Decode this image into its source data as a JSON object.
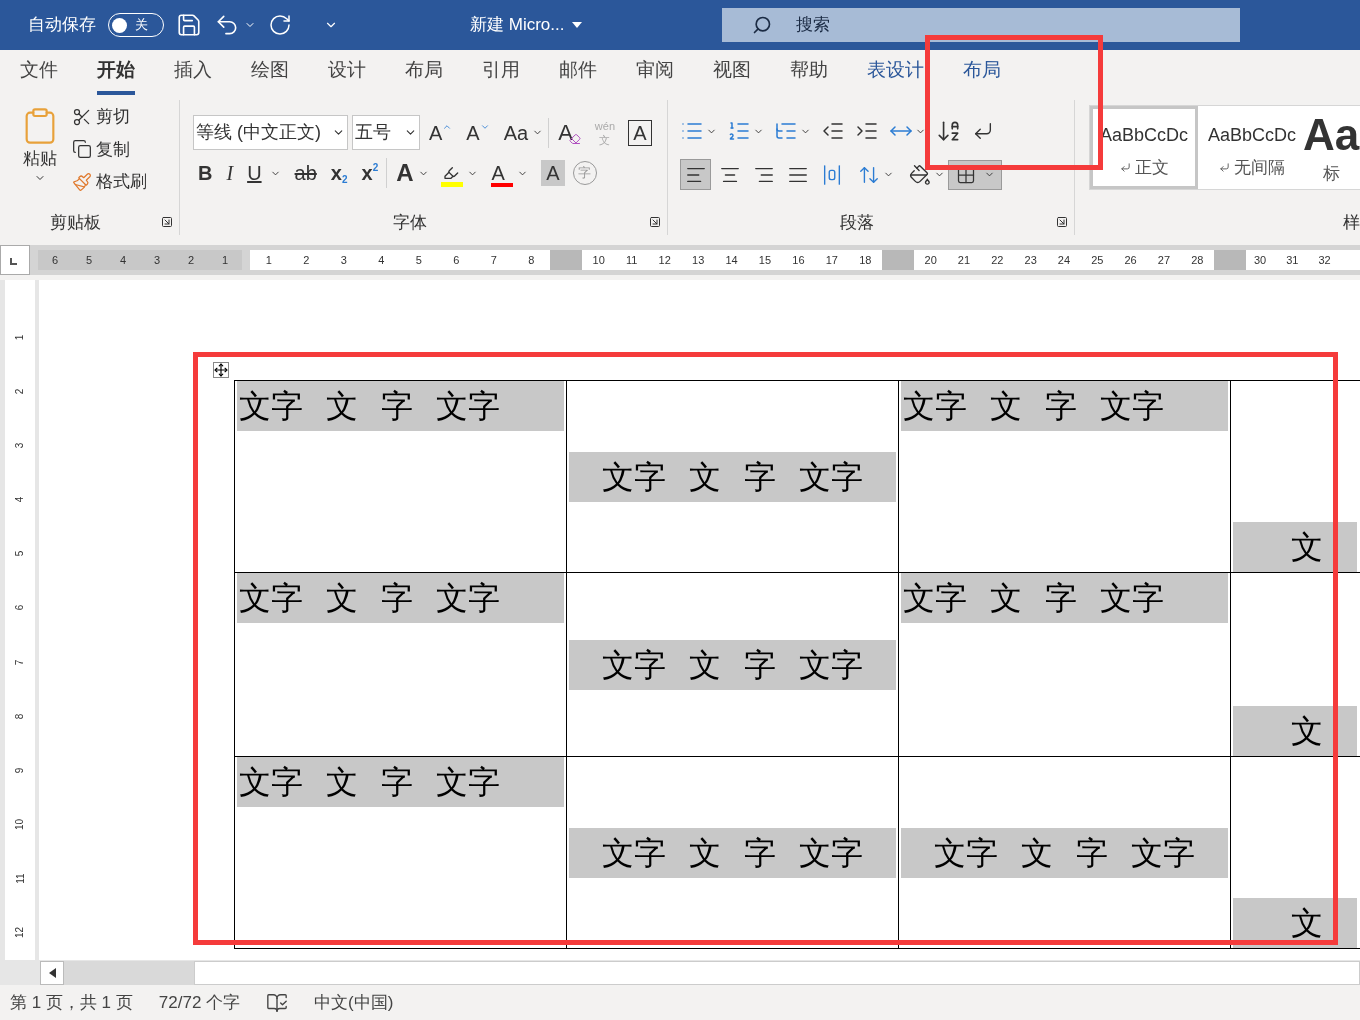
{
  "title_bar": {
    "autosave_label": "自动保存",
    "autosave": {
      "label": "关",
      "on": false
    },
    "doc_title": "新建 Micro...",
    "search": {
      "placeholder": "搜索"
    }
  },
  "tabs": [
    {
      "label": "文件",
      "selected": false,
      "kind": "normal"
    },
    {
      "label": "开始",
      "selected": true,
      "kind": "normal"
    },
    {
      "label": "插入",
      "selected": false,
      "kind": "normal"
    },
    {
      "label": "绘图",
      "selected": false,
      "kind": "normal"
    },
    {
      "label": "设计",
      "selected": false,
      "kind": "normal"
    },
    {
      "label": "布局",
      "selected": false,
      "kind": "normal"
    },
    {
      "label": "引用",
      "selected": false,
      "kind": "normal"
    },
    {
      "label": "邮件",
      "selected": false,
      "kind": "normal"
    },
    {
      "label": "审阅",
      "selected": false,
      "kind": "normal"
    },
    {
      "label": "视图",
      "selected": false,
      "kind": "normal"
    },
    {
      "label": "帮助",
      "selected": false,
      "kind": "normal"
    },
    {
      "label": "表设计",
      "selected": false,
      "kind": "context"
    },
    {
      "label": "布局",
      "selected": false,
      "kind": "context"
    }
  ],
  "clipboard": {
    "paste": "粘贴",
    "items": [
      {
        "label": "剪切",
        "kind": "cut"
      },
      {
        "label": "复制",
        "kind": "copy"
      },
      {
        "label": "格式刷",
        "kind": "painter"
      }
    ],
    "group_label": "剪贴板"
  },
  "font": {
    "font_name": "等线 (中文正文)",
    "font_size": "五号",
    "group_label": "字体",
    "row1": [
      {
        "kind": "grow",
        "glyph": "A"
      },
      {
        "kind": "shrink",
        "glyph": "A"
      },
      {
        "kind": "case",
        "glyph": "Aa"
      },
      {
        "kind": "clear",
        "glyph": "A"
      },
      {
        "kind": "phonetic",
        "top": "wén",
        "glyph": "文"
      },
      {
        "kind": "boxed",
        "glyph": "A"
      }
    ],
    "row2": [
      {
        "kind": "bold",
        "glyph": "B"
      },
      {
        "kind": "italic",
        "glyph": "I"
      },
      {
        "kind": "underline",
        "glyph": "U"
      },
      {
        "kind": "strike",
        "glyph": "ab"
      },
      {
        "kind": "sub",
        "glyph": "x",
        "small": "2"
      },
      {
        "kind": "sup",
        "glyph": "x",
        "small": "2"
      },
      {
        "kind": "effects",
        "glyph": "A"
      },
      {
        "kind": "highlight",
        "color": "#ffff00"
      },
      {
        "kind": "color",
        "glyph": "A",
        "color": "#ff0000"
      },
      {
        "kind": "shade",
        "glyph": "A"
      },
      {
        "kind": "enclose",
        "glyph": "字"
      }
    ]
  },
  "paragraph": {
    "group_label": "段落",
    "alignment": [
      {
        "kind": "left",
        "selected": true
      },
      {
        "kind": "center",
        "selected": false
      },
      {
        "kind": "right",
        "selected": false
      },
      {
        "kind": "justify",
        "selected": false
      },
      {
        "kind": "distribute",
        "selected": false
      }
    ]
  },
  "styles": {
    "items": [
      {
        "preview": "AaBbCcDc",
        "name": "正文",
        "selected": true,
        "kind": "normal"
      },
      {
        "preview": "AaBbCcDc",
        "name": "无间隔",
        "selected": false,
        "kind": "normal"
      },
      {
        "preview": "Aa",
        "name": "标",
        "selected": false,
        "kind": "heading"
      }
    ],
    "group_label": "样"
  },
  "ruler": {
    "segments": [
      {
        "shaded": true,
        "numbers": [
          "6",
          "5",
          "4",
          "3",
          "2",
          "1"
        ]
      },
      {
        "shaded": false,
        "numbers": [
          "1",
          "2",
          "3",
          "4",
          "5",
          "6",
          "7",
          "8"
        ]
      },
      {
        "shaded": false,
        "numbers": [
          "10",
          "11",
          "12",
          "13",
          "14",
          "15",
          "16",
          "17",
          "18"
        ]
      },
      {
        "shaded": false,
        "numbers": [
          "20",
          "21",
          "22",
          "23",
          "24",
          "25",
          "26",
          "27",
          "28"
        ]
      },
      {
        "shaded": false,
        "numbers": [
          "30",
          "31",
          "32"
        ]
      }
    ],
    "vertical_numbers": [
      "1",
      "2",
      "3",
      "4",
      "5",
      "6",
      "7",
      "8",
      "9",
      "10",
      "11",
      "12"
    ]
  },
  "table": {
    "rows": [
      [
        {
          "text": "文字 文 字 文字",
          "kind": "top"
        },
        {
          "text": "文字 文 字 文字",
          "kind": "middle"
        },
        {
          "text": "文字 文 字 文字",
          "kind": "top"
        },
        {
          "text": "文",
          "kind": "bottom"
        }
      ],
      [
        {
          "text": "文字 文 字 文字",
          "kind": "top"
        },
        {
          "text": "文字 文 字 文字",
          "kind": "middle"
        },
        {
          "text": "文字 文 字 文字",
          "kind": "top"
        },
        {
          "text": "文",
          "kind": "bottom"
        }
      ],
      [
        {
          "text": "文字 文 字 文字",
          "kind": "top"
        },
        {
          "text": "文字 文 字 文字",
          "kind": "middle"
        },
        {
          "text": "文字 文 字 文字",
          "kind": "middle"
        },
        {
          "text": "文",
          "kind": "bottom"
        }
      ]
    ]
  },
  "status_bar": {
    "page": "第 1 页，共 1 页",
    "words": "72/72 个字",
    "language": "中文(中国)"
  }
}
